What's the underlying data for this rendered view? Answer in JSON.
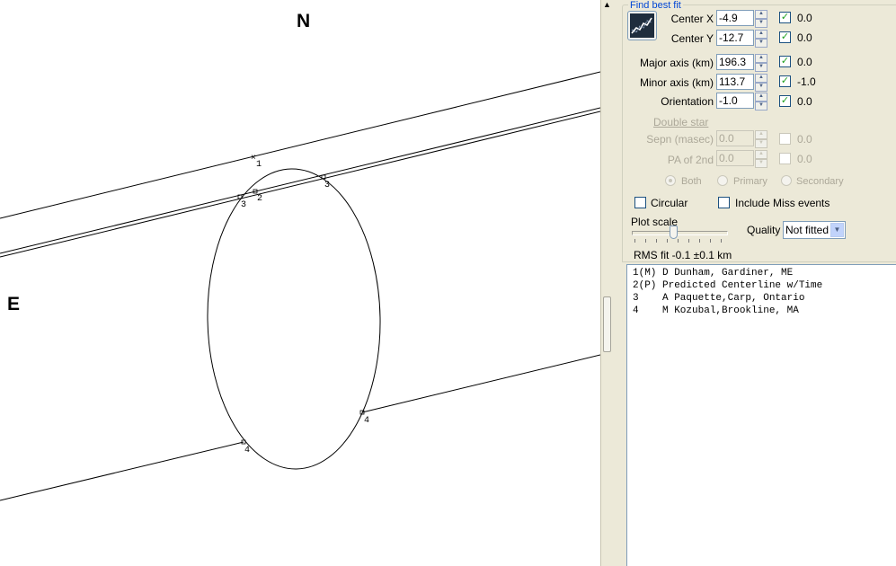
{
  "plot": {
    "north_label": "N",
    "east_label": "E",
    "chord_labels": [
      "1",
      "2",
      "3",
      "3",
      "4",
      "4"
    ]
  },
  "panel": {
    "group_title": "Find best fit",
    "center_x": {
      "label": "Center X",
      "value": "-4.9",
      "checked": true,
      "result": "0.0"
    },
    "center_y": {
      "label": "Center Y",
      "value": "-12.7",
      "checked": true,
      "result": "0.0"
    },
    "major_axis": {
      "label": "Major axis (km)",
      "value": "196.3",
      "checked": true,
      "result": "0.0"
    },
    "minor_axis": {
      "label": "Minor axis (km)",
      "value": "113.7",
      "checked": true,
      "result": "-1.0"
    },
    "orientation": {
      "label": "Orientation",
      "value": "-1.0",
      "checked": true,
      "result": "0.0"
    },
    "double_star_label": "Double star",
    "sepn": {
      "label": "Sepn (masec)",
      "value": "0.0",
      "checked": false,
      "result": "0.0"
    },
    "pa2nd": {
      "label": "PA of 2nd",
      "value": "0.0",
      "checked": false,
      "result": "0.0"
    },
    "radio_both": "Both",
    "radio_primary": "Primary",
    "radio_secondary": "Secondary",
    "circular_label": "Circular",
    "include_miss_label": "Include Miss events",
    "plot_scale_label": "Plot scale",
    "quality_label": "Quality",
    "quality_value": "Not fitted",
    "rms_text": "RMS fit -0.1 ±0.1 km"
  },
  "list": [
    "1(M) D Dunham, Gardiner, ME",
    "2(P) Predicted Centerline w/Time",
    "3    A Paquette,Carp, Ontario",
    "4    M Kozubal,Brookline, MA"
  ],
  "colors": {
    "panel_bg": "#ece9d8",
    "check_green": "#21a121",
    "title_blue": "#0046d5"
  }
}
